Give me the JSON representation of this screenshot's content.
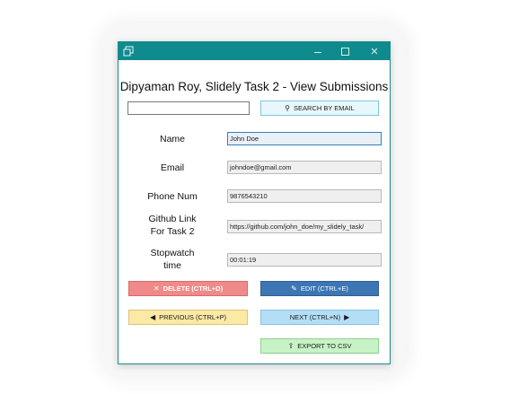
{
  "window": {
    "title_icon": "app-window-icon",
    "controls": {
      "minimize": "minimize-icon",
      "maximize": "maximize-icon",
      "close": "close-icon",
      "close_glyph": "✕"
    }
  },
  "heading": "Dipyaman Roy, Slidely Task 2 - View Submissions",
  "search": {
    "value": "",
    "button_label": "SEARCH BY EMAIL",
    "button_icon": "search-icon",
    "button_glyph": "⚲"
  },
  "fields": [
    {
      "label": "Name",
      "value": "John Doe"
    },
    {
      "label": "Email",
      "value": "johndoe@gmail.com"
    },
    {
      "label": "Phone Num",
      "value": "9876543210"
    },
    {
      "label_line1": "Github Link",
      "label_line2": "For Task 2",
      "value": "https://github.com/john_doe/my_slidely_task/"
    },
    {
      "label_line1": "Stopwatch",
      "label_line2": "time",
      "value": "00:01:19"
    }
  ],
  "actions": {
    "delete": {
      "label": "DELETE (CTRL+D)",
      "icon": "x-icon",
      "glyph": "✕",
      "color": "#f08a8a"
    },
    "edit": {
      "label": "EDIT (CTRL+E)",
      "icon": "pencil-icon",
      "glyph": "✎",
      "color": "#3c77b4"
    },
    "previous": {
      "label": "PREVIOUS (CTRL+P)",
      "icon": "triangle-left-icon",
      "glyph": "◀",
      "color": "#fbe9a4"
    },
    "next": {
      "label": "NEXT (CTRL+N)",
      "icon": "triangle-right-icon",
      "glyph": "▶",
      "color": "#b4def6"
    },
    "export": {
      "label": "EXPORT TO CSV",
      "icon": "export-icon",
      "glyph": "⇪",
      "color": "#c7f2c6"
    }
  },
  "colors": {
    "titlebar": "#0f8b8d"
  }
}
